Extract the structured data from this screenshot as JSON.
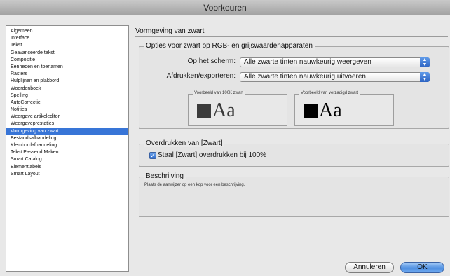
{
  "window": {
    "title": "Voorkeuren"
  },
  "sidebar": {
    "items": [
      "Algemeen",
      "Interface",
      "Tekst",
      "Geavanceerde tekst",
      "Compositie",
      "Eenheden en toenamen",
      "Rasters",
      "Hulplijnen en plakbord",
      "Woordenboek",
      "Spelling",
      "AutoCorrectie",
      "Notities",
      "Weergave artikeleditor",
      "Weergaveprestaties",
      "Vormgeving van zwart",
      "Bestandsafhandeling",
      "Klembordafhandeling",
      "Tekst Passend Maken",
      "Smart Catalog",
      "Elementlabels",
      "Smart Layout"
    ],
    "selected_index": 14
  },
  "main": {
    "section_title": "Vormgeving van zwart",
    "rgb_group": {
      "title": "Opties voor zwart op RGB- en grijswaardenapparaten",
      "screen_label": "Op het scherm:",
      "screen_value": "Alle zwarte tinten nauwkeurig weergeven",
      "print_label": "Afdrukken/exporteren:",
      "print_value": "Alle zwarte tinten nauwkeurig uitvoeren",
      "preview_100k_label": "Voorbeeld van 100K zwart",
      "preview_rich_label": "Voorbeeld van verzadigd zwart",
      "preview_text": "Aa"
    },
    "overprint_group": {
      "title": "Overdrukken van [Zwart]",
      "checkbox_label": "Staal [Zwart] overdrukken bij 100%",
      "checked": true
    },
    "description_group": {
      "title": "Beschrijving",
      "text": "Plaats de aanwijzer op een kop voor een beschrijving."
    }
  },
  "buttons": {
    "cancel": "Annuleren",
    "ok": "OK"
  },
  "colors": {
    "selection": "#3875d7",
    "swatch_100k": "#3b3b3b",
    "swatch_rich": "#000000",
    "ok_button": "#4f8fe0"
  }
}
